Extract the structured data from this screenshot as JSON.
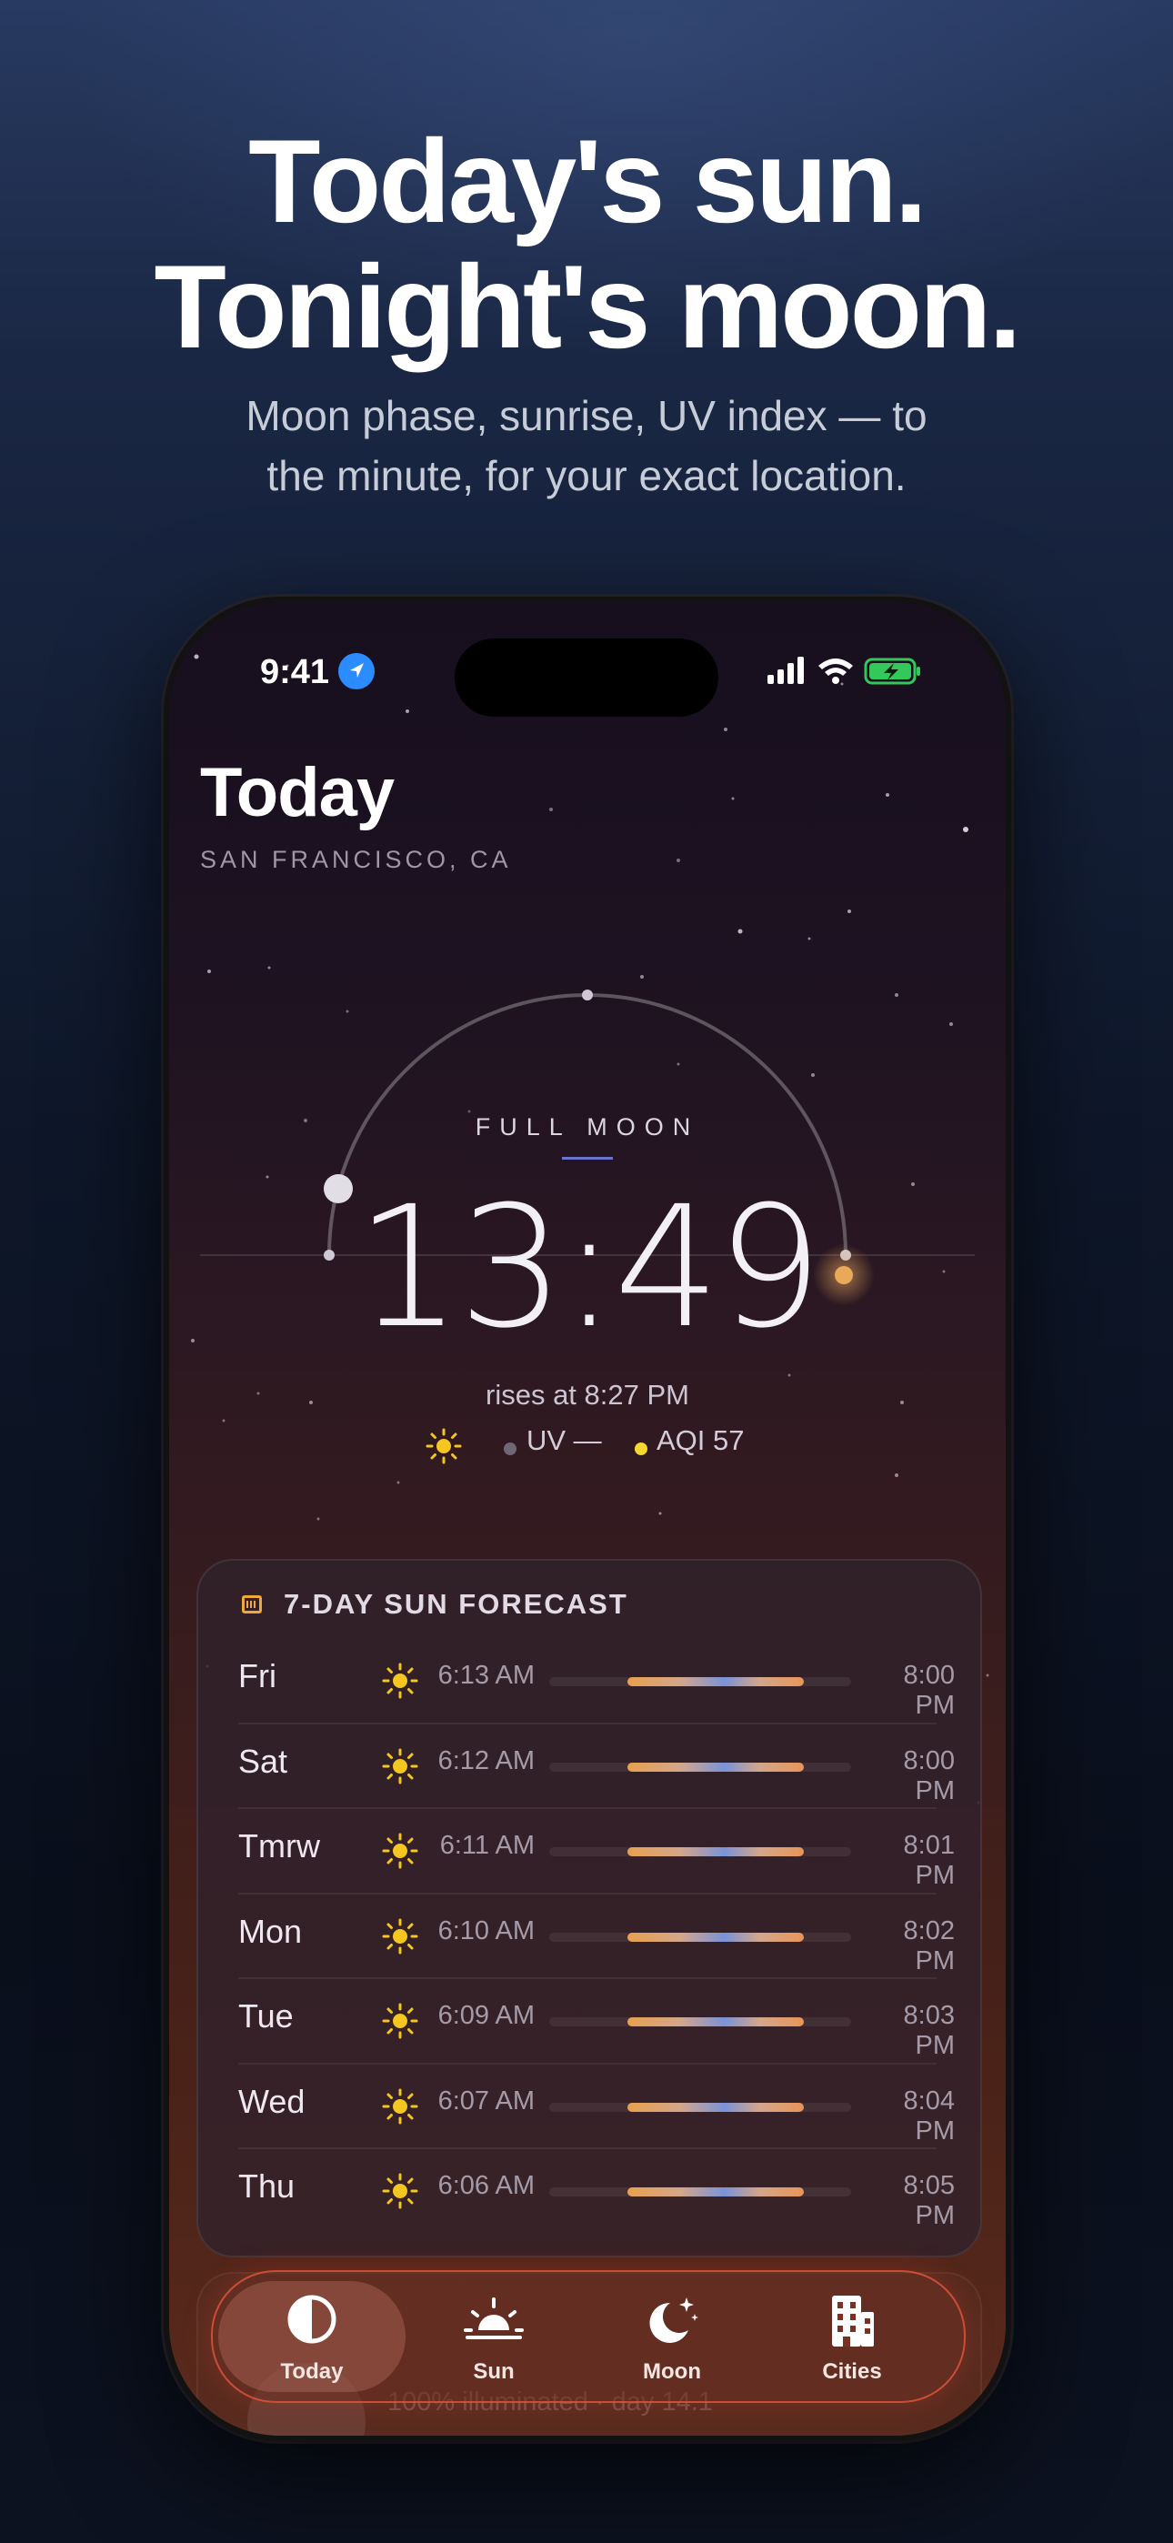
{
  "marketing": {
    "headline_line1": "Today's sun.",
    "headline_line2": "Tonight's moon.",
    "subhead_line1": "Moon phase, sunrise, UV index — to",
    "subhead_line2": "the minute, for your exact location."
  },
  "status_bar": {
    "time": "9:41",
    "icons": [
      "location-arrow-icon",
      "cellular-signal-icon",
      "wifi-icon",
      "battery-charging-icon"
    ],
    "battery_color": "#34c759"
  },
  "header": {
    "title": "Today",
    "location": "SAN FRANCISCO, CA"
  },
  "moon": {
    "phase": "FULL MOON",
    "countdown": "13:49",
    "rises": "rises at 8:27 PM",
    "uv_label": "UV —",
    "aqi_label": "AQI 57",
    "aqi_dot_color": "#f5d830"
  },
  "forecast": {
    "title": "7-DAY SUN FORECAST",
    "days": [
      {
        "day": "Fri",
        "sunrise": "6:13 AM",
        "sunset": "8:00 PM"
      },
      {
        "day": "Sat",
        "sunrise": "6:12 AM",
        "sunset": "8:00 PM"
      },
      {
        "day": "Tmrw",
        "sunrise": "6:11 AM",
        "sunset": "8:01 PM"
      },
      {
        "day": "Mon",
        "sunrise": "6:10 AM",
        "sunset": "8:02 PM"
      },
      {
        "day": "Tue",
        "sunrise": "6:09 AM",
        "sunset": "8:03 PM"
      },
      {
        "day": "Wed",
        "sunrise": "6:07 AM",
        "sunset": "8:04 PM"
      },
      {
        "day": "Thu",
        "sunrise": "6:06 AM",
        "sunset": "8:05 PM"
      }
    ]
  },
  "partial_card": {
    "text": "100% illuminated · day 14.1"
  },
  "tabbar": {
    "tabs": [
      {
        "label": "Today",
        "icon": "half-circle-icon",
        "active": true
      },
      {
        "label": "Sun",
        "icon": "sunrise-icon",
        "active": false
      },
      {
        "label": "Moon",
        "icon": "moon-stars-icon",
        "active": false
      },
      {
        "label": "Cities",
        "icon": "building-icon",
        "active": false
      }
    ],
    "accent": "#ec5a3c"
  }
}
